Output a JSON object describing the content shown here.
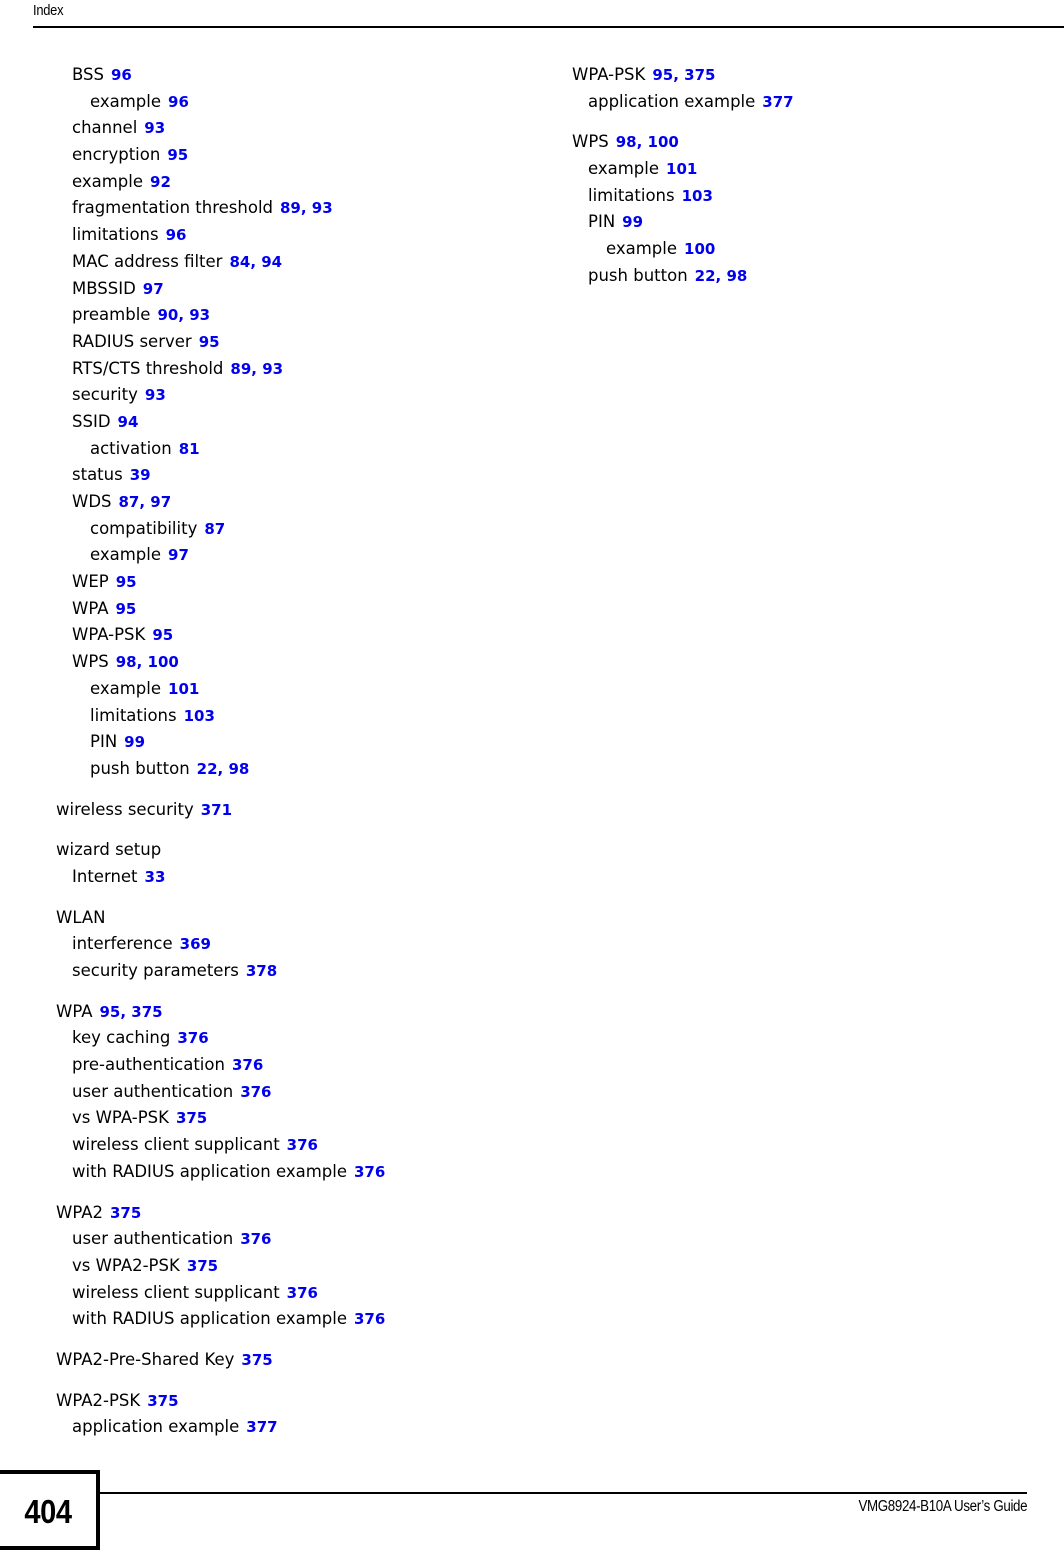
{
  "header": {
    "title": "Index"
  },
  "footer": {
    "page_number": "404",
    "guide_title": "VMG8924-B10A User’s Guide"
  },
  "colors": {
    "page_ref_blue": "#0000ee",
    "text_black": "#000000",
    "background": "#ffffff"
  },
  "index": {
    "columns": [
      {
        "name": "left-column",
        "entries": [
          {
            "level": 1,
            "term": "BSS",
            "pages": [
              "96"
            ],
            "group_start": false
          },
          {
            "level": 2,
            "term": "example",
            "pages": [
              "96"
            ],
            "group_start": false
          },
          {
            "level": 1,
            "term": "channel",
            "pages": [
              "93"
            ],
            "group_start": false
          },
          {
            "level": 1,
            "term": "encryption",
            "pages": [
              "95"
            ],
            "group_start": false
          },
          {
            "level": 1,
            "term": "example",
            "pages": [
              "92"
            ],
            "group_start": false
          },
          {
            "level": 1,
            "term": "fragmentation threshold",
            "pages": [
              "89",
              "93"
            ],
            "group_start": false
          },
          {
            "level": 1,
            "term": "limitations",
            "pages": [
              "96"
            ],
            "group_start": false
          },
          {
            "level": 1,
            "term": "MAC address filter",
            "pages": [
              "84",
              "94"
            ],
            "group_start": false
          },
          {
            "level": 1,
            "term": "MBSSID",
            "pages": [
              "97"
            ],
            "group_start": false
          },
          {
            "level": 1,
            "term": "preamble",
            "pages": [
              "90",
              "93"
            ],
            "group_start": false
          },
          {
            "level": 1,
            "term": "RADIUS server",
            "pages": [
              "95"
            ],
            "group_start": false
          },
          {
            "level": 1,
            "term": "RTS/CTS threshold",
            "pages": [
              "89",
              "93"
            ],
            "group_start": false
          },
          {
            "level": 1,
            "term": "security",
            "pages": [
              "93"
            ],
            "group_start": false
          },
          {
            "level": 1,
            "term": "SSID",
            "pages": [
              "94"
            ],
            "group_start": false
          },
          {
            "level": 2,
            "term": "activation",
            "pages": [
              "81"
            ],
            "group_start": false
          },
          {
            "level": 1,
            "term": "status",
            "pages": [
              "39"
            ],
            "group_start": false
          },
          {
            "level": 1,
            "term": "WDS",
            "pages": [
              "87",
              "97"
            ],
            "group_start": false
          },
          {
            "level": 2,
            "term": "compatibility",
            "pages": [
              "87"
            ],
            "group_start": false
          },
          {
            "level": 2,
            "term": "example",
            "pages": [
              "97"
            ],
            "group_start": false
          },
          {
            "level": 1,
            "term": "WEP",
            "pages": [
              "95"
            ],
            "group_start": false
          },
          {
            "level": 1,
            "term": "WPA",
            "pages": [
              "95"
            ],
            "group_start": false
          },
          {
            "level": 1,
            "term": "WPA-PSK",
            "pages": [
              "95"
            ],
            "group_start": false
          },
          {
            "level": 1,
            "term": "WPS",
            "pages": [
              "98",
              "100"
            ],
            "group_start": false
          },
          {
            "level": 2,
            "term": "example",
            "pages": [
              "101"
            ],
            "group_start": false
          },
          {
            "level": 2,
            "term": "limitations",
            "pages": [
              "103"
            ],
            "group_start": false
          },
          {
            "level": 2,
            "term": "PIN",
            "pages": [
              "99"
            ],
            "group_start": false
          },
          {
            "level": 2,
            "term": "push button",
            "pages": [
              "22",
              "98"
            ],
            "group_start": false
          },
          {
            "level": 0,
            "term": "wireless security",
            "pages": [
              "371"
            ],
            "group_start": true
          },
          {
            "level": 0,
            "term": "wizard setup",
            "pages": [],
            "group_start": true
          },
          {
            "level": 1,
            "term": "Internet",
            "pages": [
              "33"
            ],
            "group_start": false
          },
          {
            "level": 0,
            "term": "WLAN",
            "pages": [],
            "group_start": true
          },
          {
            "level": 1,
            "term": "interference",
            "pages": [
              "369"
            ],
            "group_start": false
          },
          {
            "level": 1,
            "term": "security parameters",
            "pages": [
              "378"
            ],
            "group_start": false
          },
          {
            "level": 0,
            "term": "WPA",
            "pages": [
              "95",
              "375"
            ],
            "group_start": true
          },
          {
            "level": 1,
            "term": "key caching",
            "pages": [
              "376"
            ],
            "group_start": false
          },
          {
            "level": 1,
            "term": "pre-authentication",
            "pages": [
              "376"
            ],
            "group_start": false
          },
          {
            "level": 1,
            "term": "user authentication",
            "pages": [
              "376"
            ],
            "group_start": false
          },
          {
            "level": 1,
            "term": "vs WPA-PSK",
            "pages": [
              "375"
            ],
            "group_start": false
          },
          {
            "level": 1,
            "term": "wireless client supplicant",
            "pages": [
              "376"
            ],
            "group_start": false
          },
          {
            "level": 1,
            "term": "with RADIUS application example",
            "pages": [
              "376"
            ],
            "group_start": false
          },
          {
            "level": 0,
            "term": "WPA2",
            "pages": [
              "375"
            ],
            "group_start": true
          },
          {
            "level": 1,
            "term": "user authentication",
            "pages": [
              "376"
            ],
            "group_start": false
          },
          {
            "level": 1,
            "term": "vs WPA2-PSK",
            "pages": [
              "375"
            ],
            "group_start": false
          },
          {
            "level": 1,
            "term": "wireless client supplicant",
            "pages": [
              "376"
            ],
            "group_start": false
          },
          {
            "level": 1,
            "term": "with RADIUS application example",
            "pages": [
              "376"
            ],
            "group_start": false
          },
          {
            "level": 0,
            "term": "WPA2-Pre-Shared Key",
            "pages": [
              "375"
            ],
            "group_start": true
          },
          {
            "level": 0,
            "term": "WPA2-PSK",
            "pages": [
              "375"
            ],
            "group_start": true
          },
          {
            "level": 1,
            "term": "application example",
            "pages": [
              "377"
            ],
            "group_start": false
          }
        ]
      },
      {
        "name": "right-column",
        "entries": [
          {
            "level": 0,
            "term": "WPA-PSK",
            "pages": [
              "95",
              "375"
            ],
            "group_start": false
          },
          {
            "level": 1,
            "term": "application example",
            "pages": [
              "377"
            ],
            "group_start": false
          },
          {
            "level": 0,
            "term": "WPS",
            "pages": [
              "98",
              "100"
            ],
            "group_start": true
          },
          {
            "level": 1,
            "term": "example",
            "pages": [
              "101"
            ],
            "group_start": false
          },
          {
            "level": 1,
            "term": "limitations",
            "pages": [
              "103"
            ],
            "group_start": false
          },
          {
            "level": 1,
            "term": "PIN",
            "pages": [
              "99"
            ],
            "group_start": false
          },
          {
            "level": 2,
            "term": "example",
            "pages": [
              "100"
            ],
            "group_start": false
          },
          {
            "level": 1,
            "term": "push button",
            "pages": [
              "22",
              "98"
            ],
            "group_start": false
          }
        ]
      }
    ]
  }
}
